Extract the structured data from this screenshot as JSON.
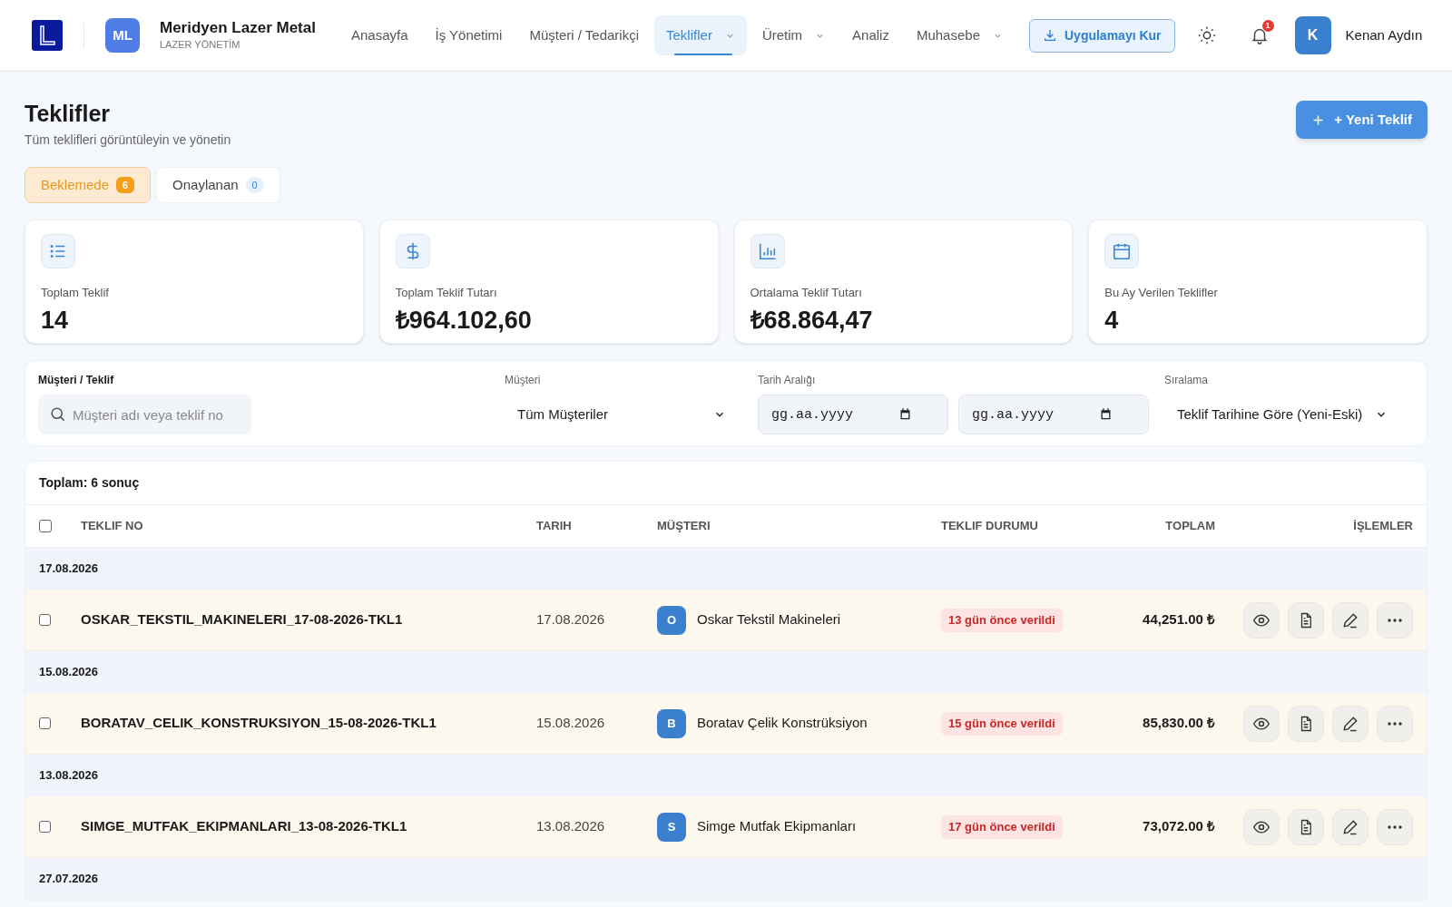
{
  "header": {
    "brand": {
      "initials": "ML",
      "name": "Meridyen Lazer Metal",
      "subtitle": "LAZER YÖNETİM"
    },
    "nav": [
      {
        "label": "Anasayfa",
        "selected": false,
        "dropdown": false
      },
      {
        "label": "İş Yönetimi",
        "selected": false,
        "dropdown": false
      },
      {
        "label": "Müşteri / Tedarikçi",
        "selected": false,
        "dropdown": false
      },
      {
        "label": "Teklifler",
        "selected": true,
        "dropdown": true
      },
      {
        "label": "Üretim",
        "selected": false,
        "dropdown": true
      },
      {
        "label": "Analiz",
        "selected": false,
        "dropdown": false
      },
      {
        "label": "Muhasebe",
        "selected": false,
        "dropdown": true
      }
    ],
    "install_button": "Uygulamayı Kur",
    "notification_count": "1",
    "user": {
      "initial": "K",
      "name": "Kenan Aydın"
    }
  },
  "page": {
    "title": "Teklifler",
    "subtitle": "Tüm teklifleri görüntüleyin ve yönetin",
    "new_button": "+ Yeni Teklif"
  },
  "status_tabs": [
    {
      "label": "Beklemede",
      "count": "6",
      "selected": true
    },
    {
      "label": "Onaylanan",
      "count": "0",
      "selected": false
    }
  ],
  "stats": [
    {
      "kind": "list",
      "label": "Toplam Teklif",
      "value": "14"
    },
    {
      "kind": "dollar",
      "label": "Toplam Teklif Tutarı",
      "value": "₺964.102,60"
    },
    {
      "kind": "chart",
      "label": "Ortalama Teklif Tutarı",
      "value": "₺68.864,47"
    },
    {
      "kind": "calendar",
      "label": "Bu Ay Verilen Teklifler",
      "value": "4"
    }
  ],
  "filters": {
    "search": {
      "label": "Müşteri / Teklif",
      "placeholder": "Müşteri adı veya teklif no"
    },
    "customer": {
      "label": "Müşteri",
      "value": "Tüm Müşteriler"
    },
    "date_range": {
      "label": "Tarih Aralığı",
      "start_placeholder": "gg.aa.yyyy",
      "end_placeholder": "gg.aa.yyyy"
    },
    "sort": {
      "label": "Sıralama",
      "value": "Teklif Tarihine Göre (Yeni-Eski)"
    }
  },
  "table": {
    "summary": "Toplam: 6 sonuç",
    "select_all_checked": false,
    "columns": [
      "TEKLIF NO",
      "TARIH",
      "MÜŞTERI",
      "TEKLIF DURUMU",
      "TOPLAM",
      "İŞLEMLER"
    ],
    "groups": [
      {
        "date": "17.08.2026",
        "rows": [
          {
            "checked": false,
            "teklif_no": "OSKAR_TEKSTIL_MAKINELERI_17-08-2026-TKL1",
            "date": "17.08.2026",
            "initial": "O",
            "customer": "Oskar Tekstil Makineleri",
            "status": "13 gün önce verildi",
            "total": "44,251.00 ₺"
          }
        ]
      },
      {
        "date": "15.08.2026",
        "rows": [
          {
            "checked": false,
            "teklif_no": "BORATAV_CELIK_KONSTRUKSIYON_15-08-2026-TKL1",
            "date": "15.08.2026",
            "initial": "B",
            "customer": "Boratav Çelik Konstrüksiyon",
            "status": "15 gün önce verildi",
            "total": "85,830.00 ₺"
          }
        ]
      },
      {
        "date": "13.08.2026",
        "rows": [
          {
            "checked": false,
            "teklif_no": "SIMGE_MUTFAK_EKIPMANLARI_13-08-2026-TKL1",
            "date": "13.08.2026",
            "initial": "S",
            "customer": "Simge Mutfak Ekipmanları",
            "status": "17 gün önce verildi",
            "total": "73,072.00 ₺"
          }
        ]
      },
      {
        "date": "27.07.2026"
      }
    ]
  }
}
